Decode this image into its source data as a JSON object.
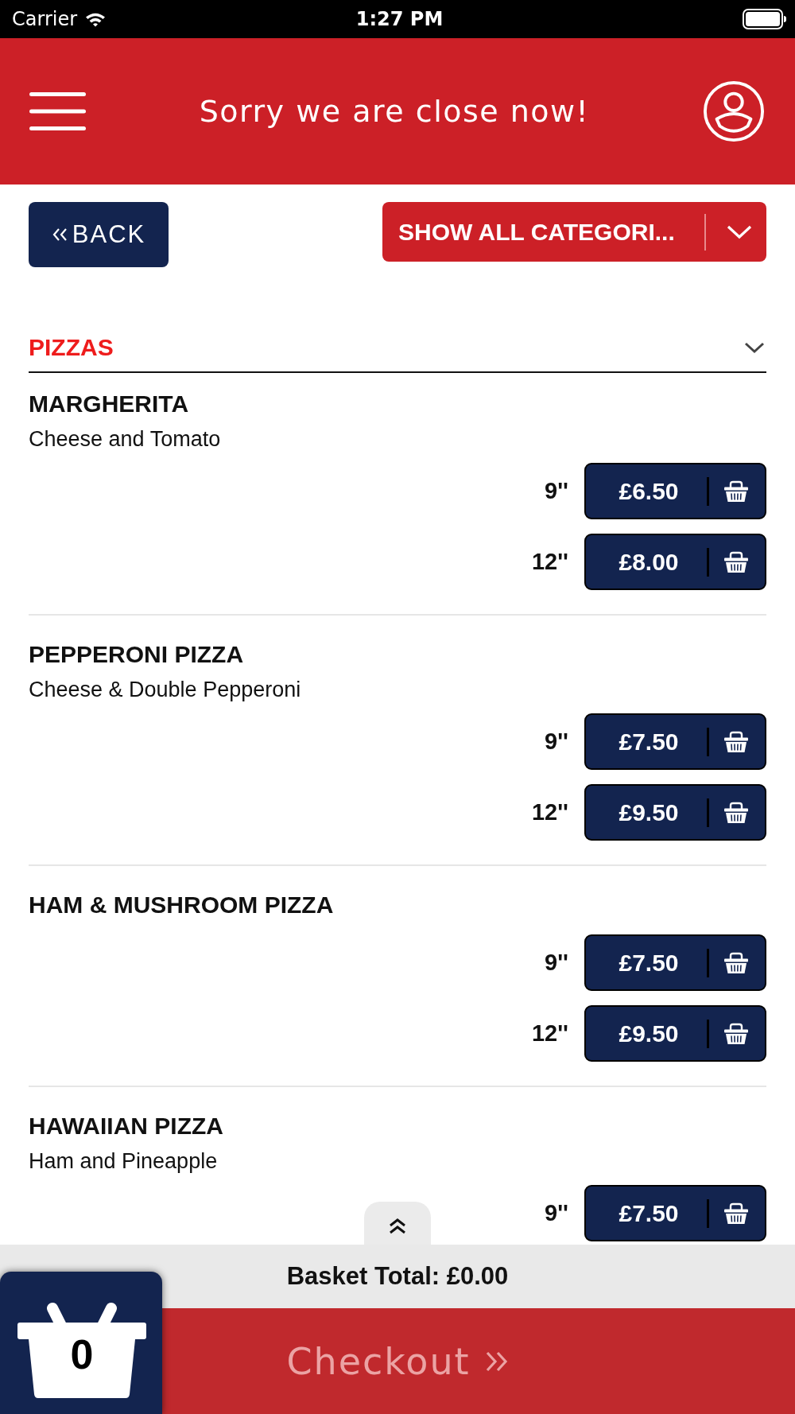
{
  "status_bar": {
    "carrier": "Carrier",
    "time": "1:27 PM"
  },
  "header": {
    "title": "Sorry we are close now!"
  },
  "toolbar": {
    "back_button": "BACK",
    "category_dropdown": "SHOW ALL CATEGORI..."
  },
  "section": {
    "title": "PIZZAS",
    "items": [
      {
        "name": "MARGHERITA",
        "description": "Cheese and Tomato",
        "prices": [
          {
            "size": "9''",
            "price": "£6.50"
          },
          {
            "size": "12''",
            "price": "£8.00"
          }
        ]
      },
      {
        "name": "PEPPERONI PIZZA",
        "description": "Cheese & Double Pepperoni",
        "prices": [
          {
            "size": "9''",
            "price": "£7.50"
          },
          {
            "size": "12''",
            "price": "£9.50"
          }
        ]
      },
      {
        "name": "HAM & MUSHROOM PIZZA",
        "prices": [
          {
            "size": "9''",
            "price": "£7.50"
          },
          {
            "size": "12''",
            "price": "£9.50"
          }
        ]
      },
      {
        "name": "HAWAIIAN PIZZA",
        "description": "Ham and Pineapple",
        "prices": [
          {
            "size": "9''",
            "price": "£7.50"
          }
        ]
      }
    ]
  },
  "basket": {
    "total": "Basket Total: £0.00",
    "count": "0"
  },
  "checkout": {
    "label": "Checkout",
    "disabled": true
  }
}
